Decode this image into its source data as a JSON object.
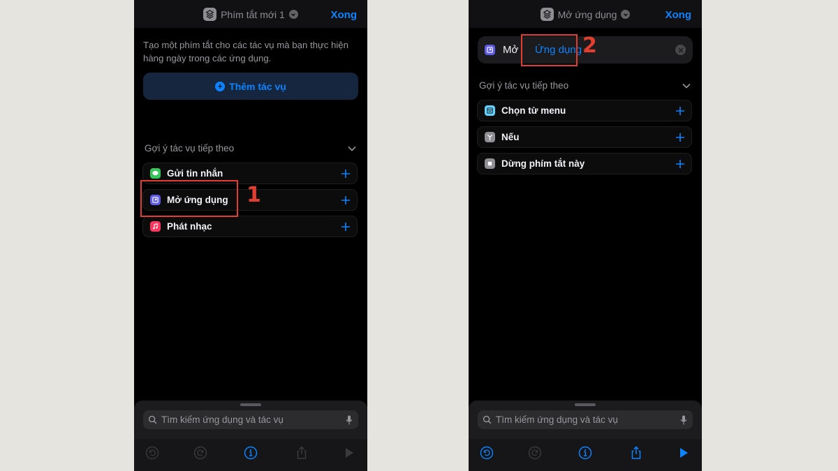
{
  "left_screen": {
    "nav": {
      "title": "Phím tắt mới 1",
      "done": "Xong"
    },
    "intro": "Tạo một phím tắt cho các tác vụ mà bạn thực hiện hàng ngày trong các ứng dụng.",
    "add_action": "Thêm tác vụ",
    "suggestions_header": "Gợi ý tác vụ tiếp theo",
    "suggestions": [
      {
        "label": "Gửi tin nhắn",
        "icon": "messages-icon",
        "color": "#34c759"
      },
      {
        "label": "Mở ứng dụng",
        "icon": "open-app-icon",
        "color": "#5e5ce6"
      },
      {
        "label": "Phát nhạc",
        "icon": "music-icon",
        "color": "#ff375f"
      }
    ],
    "search_placeholder": "Tìm kiếm ứng dụng và tác vụ",
    "step_label": "1"
  },
  "right_screen": {
    "nav": {
      "title": "Mở ứng dụng",
      "done": "Xong"
    },
    "action_verb": "Mở",
    "action_param": "Ứng dụng",
    "suggestions_header": "Gợi ý tác vụ tiếp theo",
    "suggestions": [
      {
        "label": "Chọn từ menu",
        "icon": "menu-icon",
        "color": "#64d2ff"
      },
      {
        "label": "Nếu",
        "icon": "if-branch-icon",
        "color": "#8e8e93"
      },
      {
        "label": "Dừng phím tắt này",
        "icon": "stop-icon",
        "color": "#8e8e93"
      }
    ],
    "search_placeholder": "Tìm kiếm ứng dụng và tác vụ",
    "step_label": "2"
  },
  "colors": {
    "accent": "#0a84ff",
    "callout": "#e23d2e",
    "background": "#e6e4df"
  }
}
